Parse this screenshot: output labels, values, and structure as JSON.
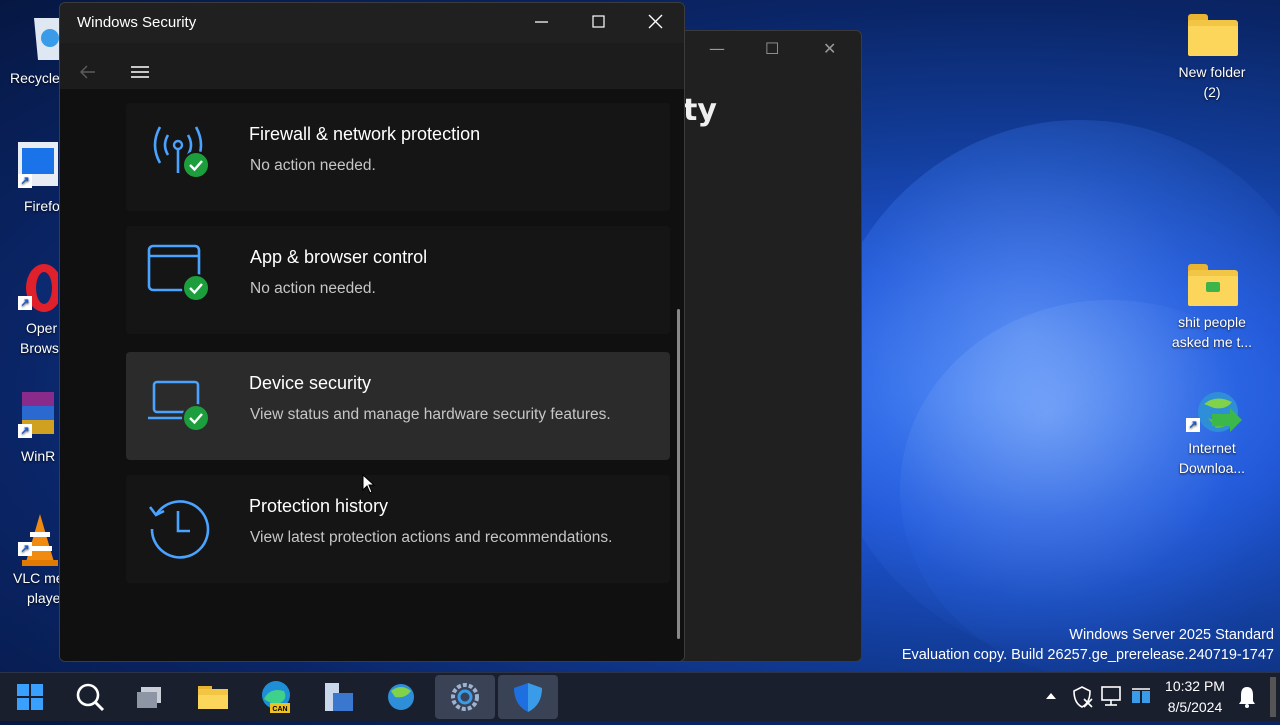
{
  "window": {
    "title": "Windows Security",
    "controls": {
      "minimize": "minimize-icon",
      "maximize": "maximize-icon",
      "close": "close-icon"
    }
  },
  "nav": {
    "back": "back-arrow-icon",
    "menu": "hamburger-menu-icon"
  },
  "cards": [
    {
      "title": "Firewall & network protection",
      "subtitle": "No action needed.",
      "icon": "firewall-antenna-icon",
      "status": "check-icon"
    },
    {
      "title": "App & browser control",
      "subtitle": "No action needed.",
      "icon": "app-browser-window-icon",
      "status": "check-icon"
    },
    {
      "title": "Device security",
      "subtitle": "View status and manage hardware security features.",
      "icon": "laptop-icon",
      "status": "check-icon"
    },
    {
      "title": "Protection history",
      "subtitle": "View latest protection actions and recommendations.",
      "icon": "history-clock-icon"
    }
  ],
  "back_window": {
    "title_fragment": "ty"
  },
  "desktop_left": [
    {
      "label": "Recycle",
      "icon": "recycle-bin-icon"
    },
    {
      "label": "Firefo",
      "icon": "firefox-icon"
    },
    {
      "label": "Oper",
      "label2": "Brows",
      "icon": "opera-icon"
    },
    {
      "label": "WinR",
      "icon": "winrar-icon"
    },
    {
      "label": "VLC me",
      "label2": "playe",
      "icon": "vlc-icon"
    }
  ],
  "desktop_right": [
    {
      "label": "New folder",
      "label2": "(2)",
      "icon": "folder-icon"
    },
    {
      "label": "shit people",
      "label2": "asked me t...",
      "icon": "folder-icon"
    },
    {
      "label": "Internet",
      "label2": "Downloa...",
      "icon": "internet-download-manager-icon"
    }
  ],
  "watermark": {
    "line1": "Windows Server 2025 Standard",
    "line2": "Evaluation copy. Build 26257.ge_prerelease.240719-1747"
  },
  "taskbar": {
    "items": [
      "start-icon",
      "search-icon",
      "task-view-icon",
      "file-explorer-icon",
      "edge-icon",
      "server-manager-icon",
      "network-icon",
      "settings-icon",
      "windows-security-icon"
    ],
    "tray": [
      "chevron-up-icon",
      "defender-tray-icon",
      "network-tray-icon",
      "bluetooth-tray-icon"
    ],
    "time": "10:32 PM",
    "date": "8/5/2024",
    "edge_badge": "CAN"
  },
  "colors": {
    "accent": "#4aa3ff",
    "check": "#1d9e3c",
    "window_bg": "#1c1c1c"
  }
}
